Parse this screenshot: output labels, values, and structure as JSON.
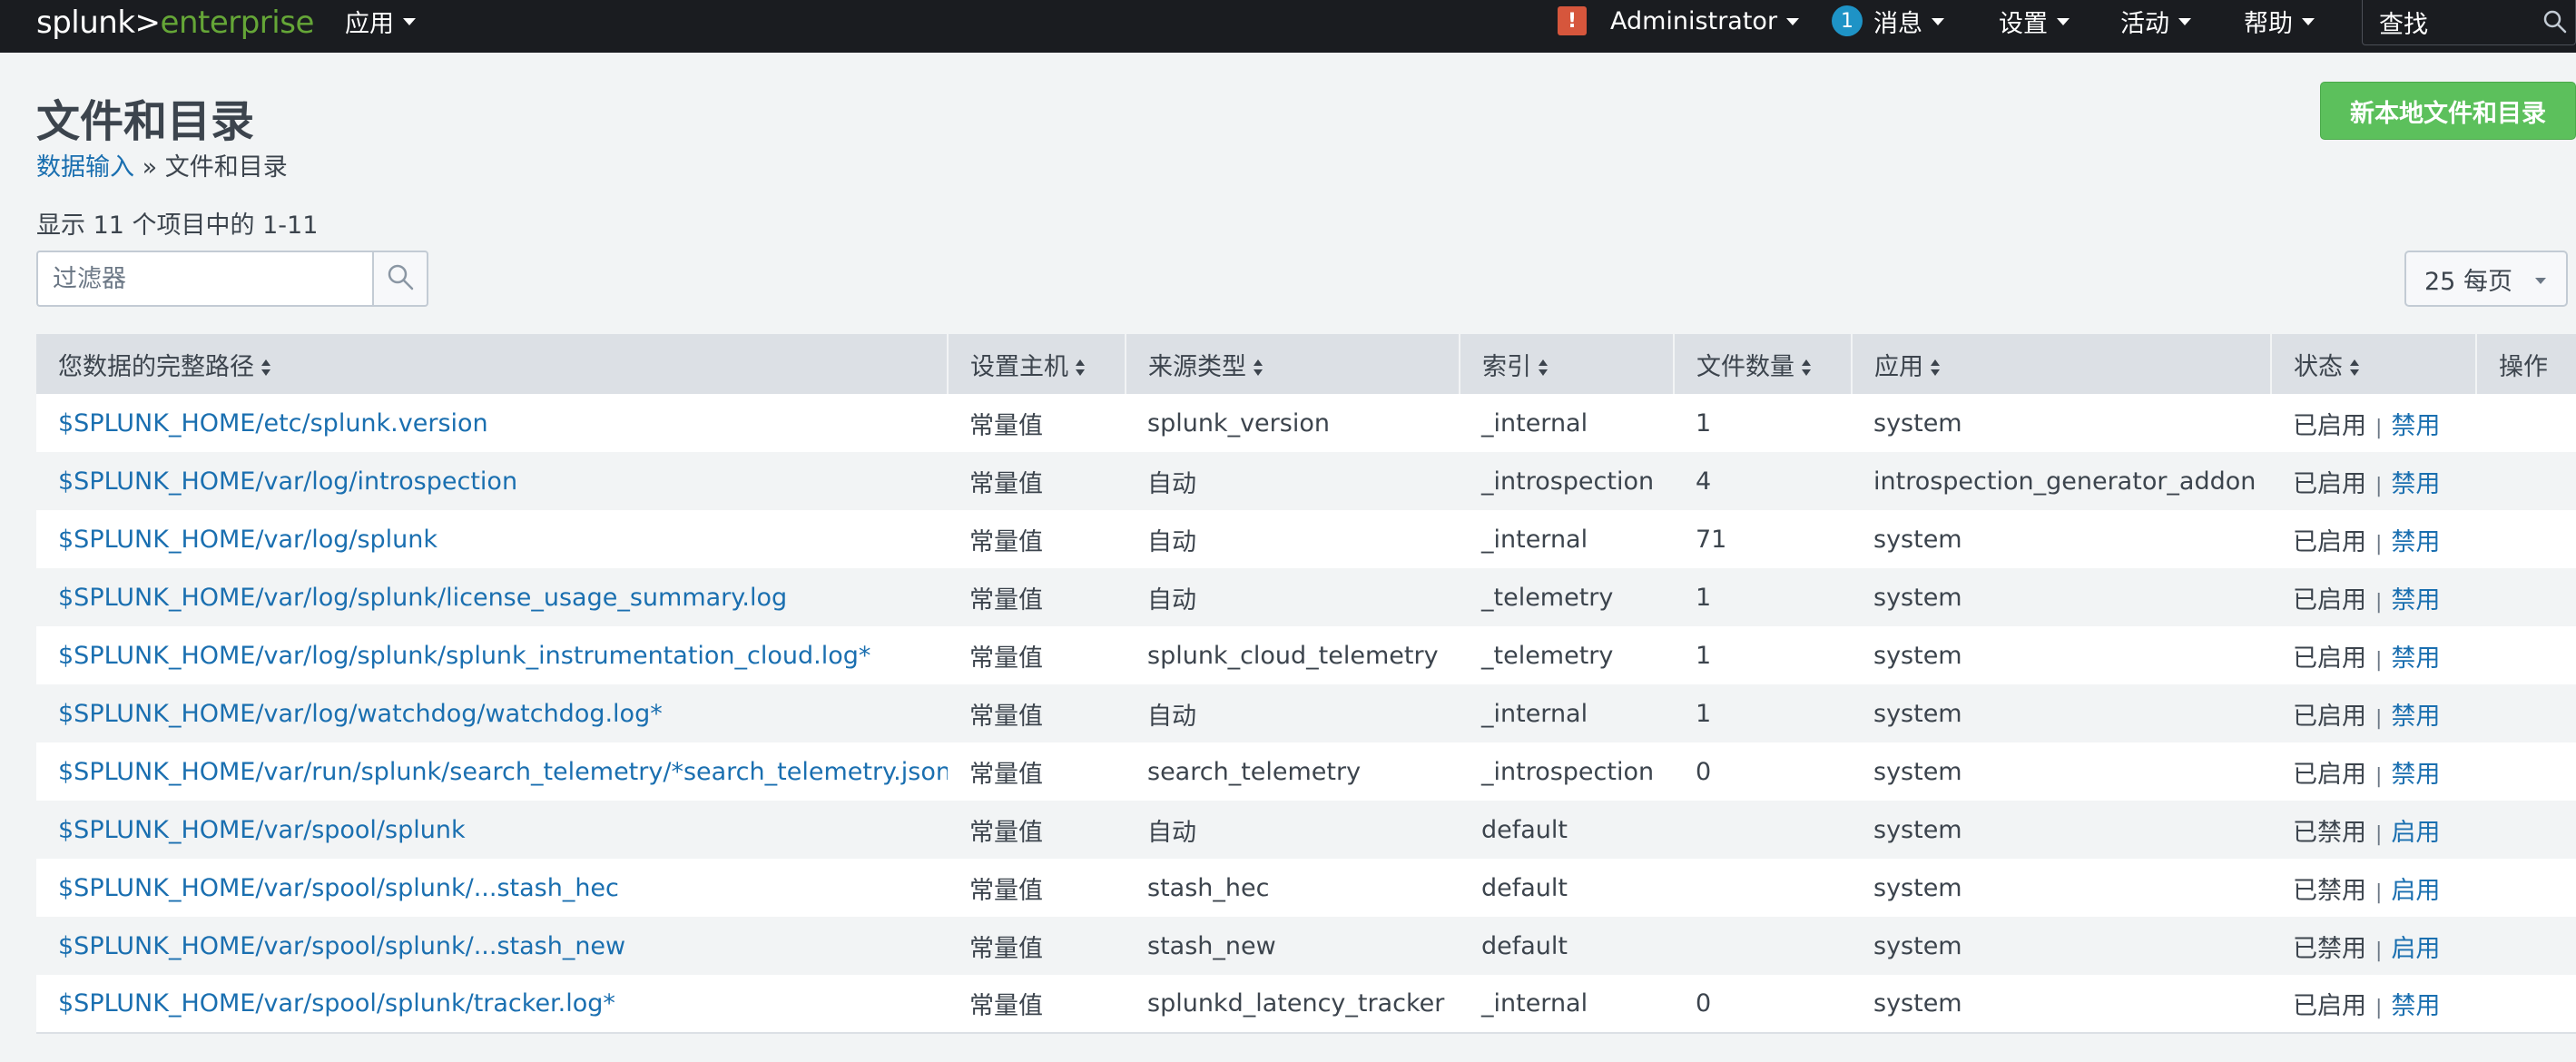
{
  "topbar": {
    "logo_main": "splunk>",
    "logo_sub": "enterprise",
    "apps_label": "应用",
    "alert_badge": "!",
    "user_label": "Administrator",
    "messages_count": "1",
    "messages_label": "消息",
    "settings_label": "设置",
    "activity_label": "活动",
    "help_label": "帮助",
    "search_label": "查找"
  },
  "page": {
    "title": "文件和目录",
    "breadcrumb_link": "数据输入",
    "breadcrumb_sep": "»",
    "breadcrumb_current": "文件和目录",
    "new_button": "新本地文件和目录",
    "count_text": "显示 11 个项目中的 1-11",
    "filter_placeholder": "过滤器",
    "per_page": "25 每页"
  },
  "table": {
    "headers": {
      "path": "您数据的完整路径",
      "host": "设置主机",
      "sourcetype": "来源类型",
      "index": "索引",
      "filecount": "文件数量",
      "app": "应用",
      "status": "状态",
      "actions": "操作"
    },
    "rows": [
      {
        "path": "$SPLUNK_HOME/etc/splunk.version",
        "host": "常量值",
        "sourcetype": "splunk_version",
        "index": "_internal",
        "filecount": "1",
        "app": "system",
        "status": "已启用",
        "toggle": "禁用"
      },
      {
        "path": "$SPLUNK_HOME/var/log/introspection",
        "host": "常量值",
        "sourcetype": "自动",
        "index": "_introspection",
        "filecount": "4",
        "app": "introspection_generator_addon",
        "status": "已启用",
        "toggle": "禁用"
      },
      {
        "path": "$SPLUNK_HOME/var/log/splunk",
        "host": "常量值",
        "sourcetype": "自动",
        "index": "_internal",
        "filecount": "71",
        "app": "system",
        "status": "已启用",
        "toggle": "禁用"
      },
      {
        "path": "$SPLUNK_HOME/var/log/splunk/license_usage_summary.log",
        "host": "常量值",
        "sourcetype": "自动",
        "index": "_telemetry",
        "filecount": "1",
        "app": "system",
        "status": "已启用",
        "toggle": "禁用"
      },
      {
        "path": "$SPLUNK_HOME/var/log/splunk/splunk_instrumentation_cloud.log*",
        "host": "常量值",
        "sourcetype": "splunk_cloud_telemetry",
        "index": "_telemetry",
        "filecount": "1",
        "app": "system",
        "status": "已启用",
        "toggle": "禁用"
      },
      {
        "path": "$SPLUNK_HOME/var/log/watchdog/watchdog.log*",
        "host": "常量值",
        "sourcetype": "自动",
        "index": "_internal",
        "filecount": "1",
        "app": "system",
        "status": "已启用",
        "toggle": "禁用"
      },
      {
        "path": "$SPLUNK_HOME/var/run/splunk/search_telemetry/*search_telemetry.json",
        "host": "常量值",
        "sourcetype": "search_telemetry",
        "index": "_introspection",
        "filecount": "0",
        "app": "system",
        "status": "已启用",
        "toggle": "禁用"
      },
      {
        "path": "$SPLUNK_HOME/var/spool/splunk",
        "host": "常量值",
        "sourcetype": "自动",
        "index": "default",
        "filecount": "",
        "app": "system",
        "status": "已禁用",
        "toggle": "启用"
      },
      {
        "path": "$SPLUNK_HOME/var/spool/splunk/...stash_hec",
        "host": "常量值",
        "sourcetype": "stash_hec",
        "index": "default",
        "filecount": "",
        "app": "system",
        "status": "已禁用",
        "toggle": "启用"
      },
      {
        "path": "$SPLUNK_HOME/var/spool/splunk/...stash_new",
        "host": "常量值",
        "sourcetype": "stash_new",
        "index": "default",
        "filecount": "",
        "app": "system",
        "status": "已禁用",
        "toggle": "启用"
      },
      {
        "path": "$SPLUNK_HOME/var/spool/splunk/tracker.log*",
        "host": "常量值",
        "sourcetype": "splunkd_latency_tracker",
        "index": "_internal",
        "filecount": "0",
        "app": "system",
        "status": "已启用",
        "toggle": "禁用"
      }
    ]
  },
  "colors": {
    "topbar_bg": "#1a1c20",
    "logo_accent": "#65a637",
    "link": "#1a6fb0",
    "primary_button": "#5cc05c",
    "alert": "#d6563c",
    "message_badge": "#1e93c6"
  },
  "icons": {
    "filter_search": "search-icon",
    "top_search": "search-icon",
    "dropdown": "caret-down-icon",
    "sort": "sort-icon"
  }
}
